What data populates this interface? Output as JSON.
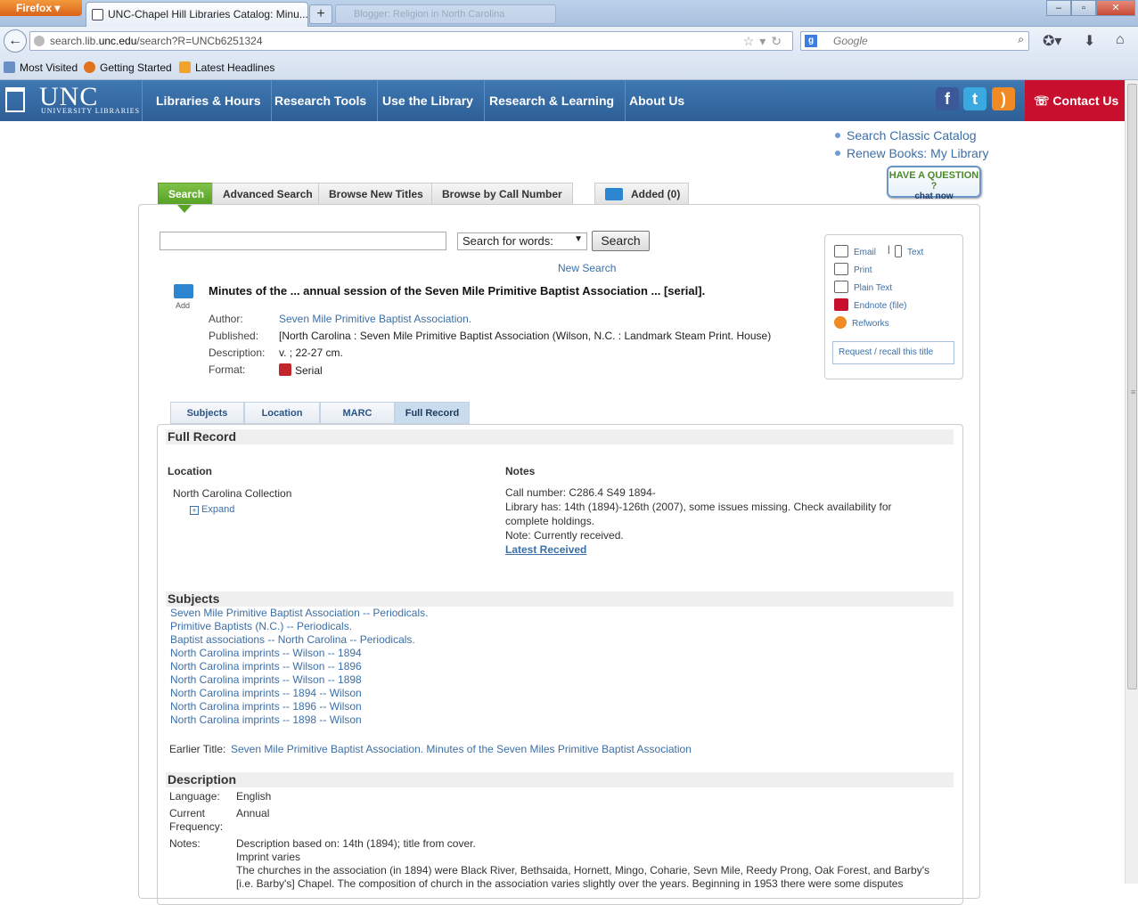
{
  "browser": {
    "menu_button": "Firefox",
    "tab_title": "UNC-Chapel Hill Libraries Catalog: Minu...",
    "new_tab": "+",
    "ghost_tab_title": "Blogger: Religion in North Carolina",
    "url_prefix": "search.lib.",
    "url_host": "unc.edu",
    "url_suffix": "/search?R=UNCb6251324",
    "search_placeholder": "Google",
    "bookmarks": [
      "Most Visited",
      "Getting Started",
      "Latest Headlines"
    ]
  },
  "site": {
    "logo_text": "UNC",
    "logo_subtext": "UNIVERSITY LIBRARIES",
    "nav": [
      "Libraries & Hours",
      "Research Tools",
      "Use the Library",
      "Research & Learning",
      "About Us"
    ],
    "contact": "Contact Us",
    "top_links": [
      "Search Classic Catalog",
      "Renew Books: My Library"
    ],
    "chat_badge": {
      "line1": "HAVE A QUESTION ?",
      "line2": "chat now"
    }
  },
  "search": {
    "tabs": [
      "Search",
      "Advanced Search",
      "Browse New Titles",
      "Browse by Call Number"
    ],
    "added": "Added (0)",
    "query_value": "",
    "mode_selected": "Search for words:",
    "button": "Search",
    "new_search": "New Search"
  },
  "record": {
    "add_label": "Add",
    "title": "Minutes of the ... annual session of the Seven Mile Primitive Baptist Association ... [serial].",
    "fields": {
      "author_label": "Author:",
      "author": "Seven Mile Primitive Baptist Association.",
      "published_label": "Published:",
      "published": "[North Carolina : Seven Mile Primitive Baptist Association (Wilson, N.C. : Landmark Steam Print. House)",
      "description_label": "Description:",
      "description": "v. ; 22-27 cm.",
      "format_label": "Format:",
      "format": "Serial"
    }
  },
  "tools": {
    "email": "Email",
    "separator": "|",
    "text": "Text",
    "print": "Print",
    "plain_text": "Plain Text",
    "endnote": "Endnote (file)",
    "refworks": "Refworks",
    "request": "Request / recall this title"
  },
  "record_tabs": [
    "Subjects",
    "Location",
    "MARC",
    "Full Record"
  ],
  "full_record": {
    "heading": "Full Record",
    "location_heading": "Location",
    "location": "North Carolina Collection",
    "expand": "Expand",
    "notes_heading": "Notes",
    "call_number": "Call number: C286.4 S49 1894-",
    "library_has_1": "Library has: 14th (1894)-126th (2007), some issues missing. Check availability for",
    "library_has_2": "complete holdings.",
    "note": "Note: Currently received.",
    "latest_received": "Latest Received",
    "subjects_heading": "Subjects",
    "subjects": [
      "Seven Mile Primitive Baptist Association -- Periodicals.",
      "Primitive Baptists (N.C.) -- Periodicals.",
      "Baptist associations -- North Carolina -- Periodicals.",
      "North Carolina imprints -- Wilson -- 1894",
      "North Carolina imprints -- Wilson -- 1896",
      "North Carolina imprints -- Wilson -- 1898",
      "North Carolina imprints -- 1894 -- Wilson",
      "North Carolina imprints -- 1896 -- Wilson",
      "North Carolina imprints -- 1898 -- Wilson"
    ],
    "earlier_title_label": "Earlier Title:",
    "earlier_title": "Seven Mile Primitive Baptist Association. Minutes of the Seven Miles Primitive Baptist Association",
    "description_heading": "Description",
    "language_label": "Language:",
    "language": "English",
    "frequency_label_1": "Current",
    "frequency_label_2": "Frequency:",
    "frequency": "Annual",
    "notes_label": "Notes:",
    "notes_1": "Description based on: 14th (1894); title from cover.",
    "notes_2": "Imprint varies",
    "notes_3": "The churches in the association (in 1894) were Black River, Bethsaida, Hornett, Mingo, Coharie, Sevn Mile, Reedy Prong, Oak Forest, and Barby's",
    "notes_4": "[i.e. Barby's] Chapel. The composition of church in the association varies slightly over the years. Beginning in 1953 there were some disputes"
  },
  "colors": {
    "link": "#3b6fa8",
    "header": "#2e5f96",
    "contact": "#c8102e",
    "search_tab": "#58a226"
  }
}
